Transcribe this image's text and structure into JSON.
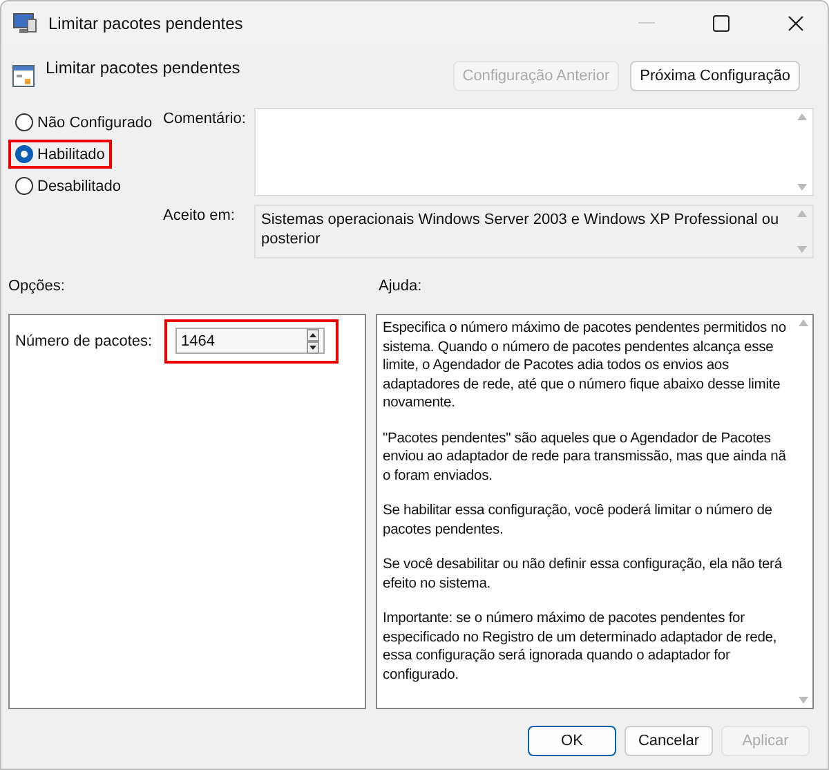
{
  "window": {
    "title": "Limitar pacotes pendentes"
  },
  "header": {
    "title": "Limitar pacotes pendentes",
    "buttons": [
      {
        "label": "Configuração Anterior",
        "disabled": true
      },
      {
        "label": "Próxima Configuração",
        "disabled": false
      }
    ]
  },
  "state_options": [
    {
      "label": "Não Configurado",
      "selected": false,
      "highlighted": false
    },
    {
      "label": "Habilitado",
      "selected": true,
      "highlighted": true
    },
    {
      "label": "Desabilitado",
      "selected": false,
      "highlighted": false
    }
  ],
  "comment": {
    "label": "Comentário:"
  },
  "supported_on": {
    "label": "Aceito em:",
    "value": "Sistemas operacionais Windows Server 2003 e Windows XP Professional ou posterior"
  },
  "options": {
    "label": "Opções:",
    "field": {
      "label": "Número de pacotes:",
      "value": "1464",
      "highlighted": true
    }
  },
  "help": {
    "label": "Ajuda:",
    "paragraphs": [
      "Especifica o número máximo de pacotes pendentes permitidos no sistema. Quando o número de pacotes pendentes alcança esse limite, o Agendador de Pacotes adia todos os envios aos adaptadores de rede, até que o número fique abaixo desse limite novamente.",
      "\"Pacotes pendentes\" são aqueles que o Agendador de Pacotes enviou ao adaptador de rede para transmissão, mas que ainda nã\no foram enviados.",
      "Se habilitar essa configuração, você poderá limitar o número de pacotes pendentes.",
      "Se você desabilitar ou não definir essa configuração, ela não terá efeito no sistema.",
      "Importante: se o número máximo de pacotes pendentes for especificado no Registro de um determinado adaptador de rede, essa configuração será ignorada quando o adaptador for configurado."
    ]
  },
  "buttons": [
    {
      "label": "OK",
      "kind": "default",
      "disabled": false
    },
    {
      "label": "Cancelar",
      "kind": "normal",
      "disabled": false
    },
    {
      "label": "Aplicar",
      "kind": "normal",
      "disabled": true
    }
  ]
}
